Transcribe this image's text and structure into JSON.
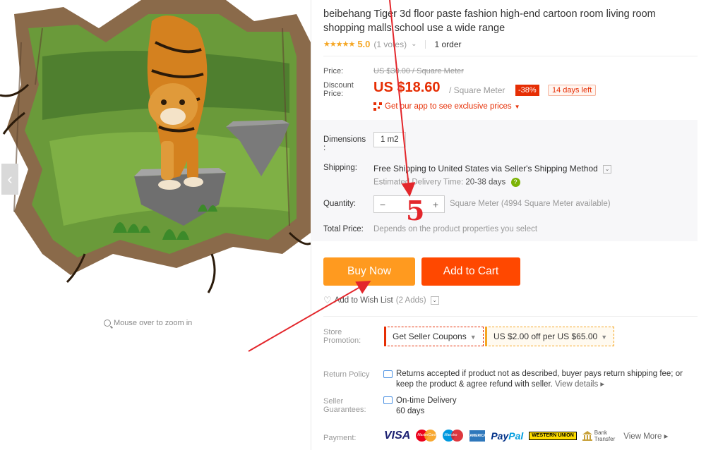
{
  "product": {
    "title": "beibehang Tiger 3d floor paste fashion high-end cartoon room living room shopping malls school use a wide range"
  },
  "rating": {
    "stars": "★★★★★",
    "value": "5.0",
    "votes": "(1 votes)",
    "orders": "1 order"
  },
  "price": {
    "price_label": "Price:",
    "original": "US $30.00 / Square Meter",
    "discount_label_1": "Discount",
    "discount_label_2": "Price:",
    "discounted": "US $18.60",
    "per_unit": "/ Square Meter",
    "discount_badge": "-38%",
    "days_left": "14 days left",
    "app_promo": "Get our app to see exclusive prices"
  },
  "options": {
    "dimensions_label_1": "Dimensions",
    "dimensions_label_2": ":",
    "dimensions_value": "1 m2",
    "shipping_label": "Shipping:",
    "shipping_text": "Free Shipping to United States via Seller's Shipping Method",
    "estimated_label": "Estimated Delivery Time:",
    "estimated_value": "20-38 days",
    "quantity_label": "Quantity:",
    "quantity_minus": "−",
    "quantity_plus": "+",
    "quantity_value": "",
    "quantity_available": "Square Meter (4994 Square Meter available)",
    "total_label": "Total Price:",
    "total_value": "Depends on the product properties you select"
  },
  "actions": {
    "buy_now": "Buy Now",
    "add_to_cart": "Add to Cart",
    "wish_list": "Add to Wish List",
    "wish_count": "(2 Adds)"
  },
  "store": {
    "promotion_label_1": "Store",
    "promotion_label_2": "Promotion:",
    "coupon_1": "Get Seller Coupons",
    "coupon_2": "US $2.00 off per US $65.00",
    "return_label": "Return Policy",
    "return_text": "Returns accepted if product not as described, buyer pays return shipping fee; or keep the product & agree refund with seller.",
    "view_details": "View details ▸",
    "guarantee_label_1": "Seller",
    "guarantee_label_2": "Guarantees:",
    "guarantee_text": "On-time Delivery",
    "guarantee_days": "60 days",
    "payment_label": "Payment:",
    "payments": {
      "visa": "VISA",
      "mastercard": "MasterCard",
      "maestro": "Maestro",
      "amex": "AMERICAN EXPRESS",
      "paypal_a": "Pay",
      "paypal_b": "Pal",
      "western_union": "WESTERN UNION",
      "bank_1": "Bank",
      "bank_2": "Transfer"
    },
    "view_more": "View More ▸"
  },
  "gallery": {
    "zoom_hint": "Mouse over to zoom in",
    "prev_glyph": "‹"
  },
  "annotation": {
    "number": "5",
    "color": "#e3262b"
  }
}
